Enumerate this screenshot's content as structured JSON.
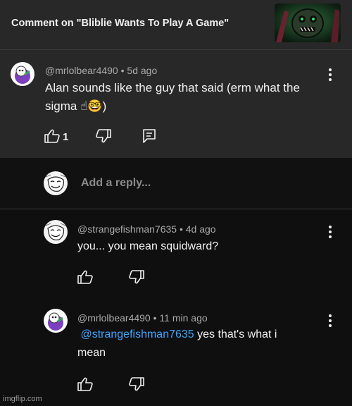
{
  "header": {
    "title": "Comment on \"Bliblie Wants To Play A Game\""
  },
  "top_comment": {
    "author": "@mrlolbear4490",
    "time": "5d ago",
    "text_line1": "Alan sounds like the guy that said (erm what the",
    "text_line2": "sigma ☝🤓)",
    "like_count": "1"
  },
  "reply_input": {
    "placeholder": "Add a reply..."
  },
  "replies": [
    {
      "author": "@strangefishman7635",
      "time": "4d ago",
      "text": "you... you mean squidward?"
    },
    {
      "author": "@mrlolbear4490",
      "time": "11 min ago",
      "mention": "@strangefishman7635",
      "text_after_mention": " yes that's what i",
      "text_line2": "mean"
    }
  ],
  "watermark": "imgflip.com",
  "colors": {
    "background": "#0f0f0f",
    "panel": "#282828",
    "mention": "#3ea6ff",
    "meta_text": "#aaaaaa"
  },
  "icons": [
    "thumbs-up-icon",
    "thumbs-down-icon",
    "reply-icon",
    "more-vert-icon"
  ]
}
